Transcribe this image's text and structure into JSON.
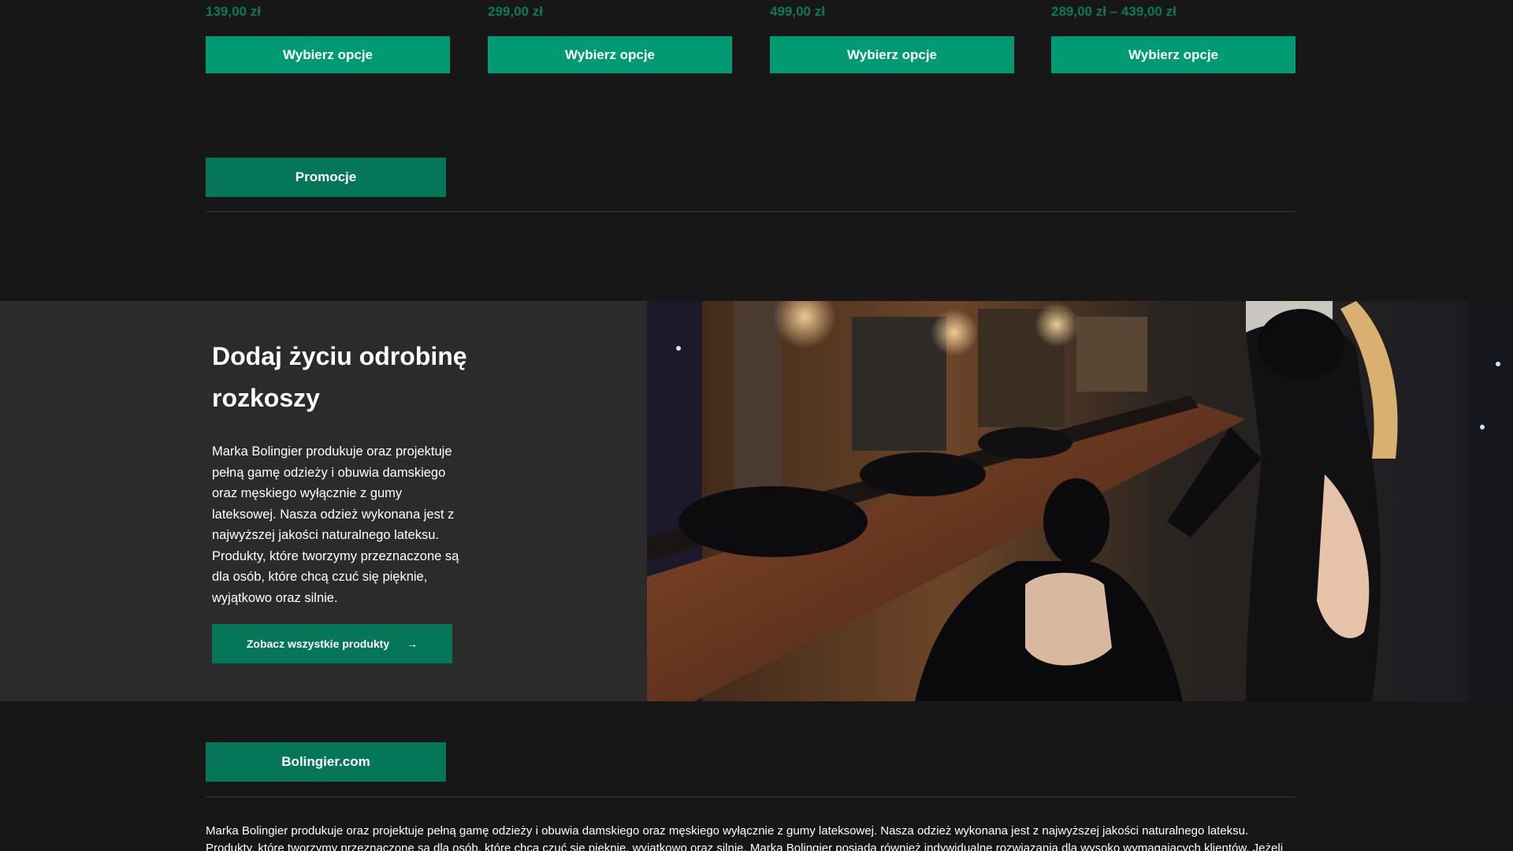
{
  "products": [
    {
      "price": "139,00 zł",
      "button": "Wybierz opcje"
    },
    {
      "price": "299,00 zł",
      "button": "Wybierz opcje"
    },
    {
      "price": "499,00 zł",
      "button": "Wybierz opcje"
    },
    {
      "price": "289,00 zł – 439,00 zł",
      "button": "Wybierz opcje"
    }
  ],
  "promo_section": {
    "label": "Promocje"
  },
  "banner": {
    "title": "Dodaj życiu odrobinę rozkoszy",
    "text": "Marka Bolingier produkuje oraz projektuje pełną gamę odzieży i obuwia damskiego oraz męskiego wyłącznie z gumy lateksowej. Nasza odzież wykonana jest z najwyższej jakości naturalnego lateksu. Produkty, które tworzymy przeznaczone są dla osób, które chcą czuć się pięknie, wyjątkowo oraz silnie.",
    "cta_label": "Zobacz wszystkie produkty",
    "cta_arrow": "→",
    "photo_icon": "photo-latex-barbershop"
  },
  "site_section": {
    "label": "Bolingier.com"
  },
  "footer": {
    "text": "Marka Bolingier produkuje oraz projektuje pełną gamę odzieży i obuwia damskiego oraz męskiego wyłącznie z gumy lateksowej.  Nasza odzież wykonana jest z najwyższej jakości naturalnego lateksu. Produkty, które tworzymy przeznaczone są dla osób, które chcą czuć się pięknie, wyjątkowo oraz silnie. Marka Bolingier posiada również indywidualne rozwiązania dla wysoko wymagających klientów. Jeżeli potrzebujesz"
  },
  "colors": {
    "background": "#171717",
    "panel": "#2b2b2b",
    "accent": "#009b72",
    "accent_dark": "#057758",
    "price": "#0b7a55"
  }
}
